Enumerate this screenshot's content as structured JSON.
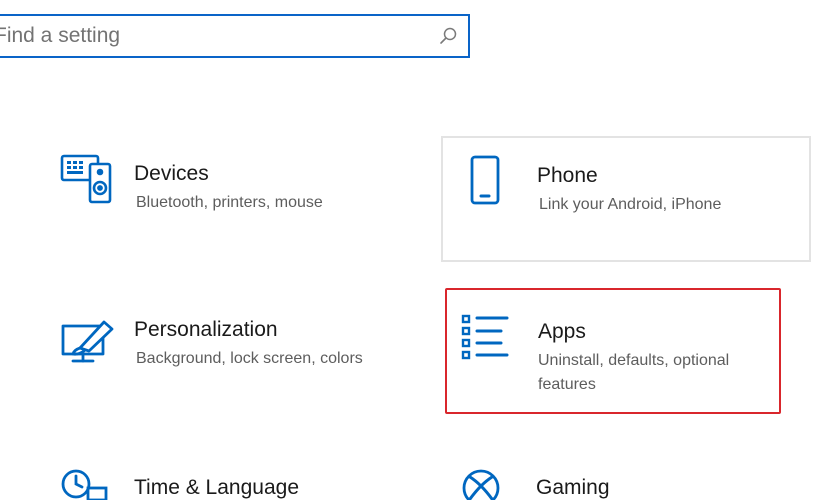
{
  "search": {
    "placeholder": "Find a setting"
  },
  "tiles": [
    {
      "title": "Devices",
      "description": "Bluetooth, printers, mouse",
      "icon": "devices-icon"
    },
    {
      "title": "Phone",
      "description": "Link your Android, iPhone",
      "icon": "phone-icon"
    },
    {
      "title": "Personalization",
      "description": "Background, lock screen, colors",
      "icon": "personalization-icon"
    },
    {
      "title": "Apps",
      "description": "Uninstall, defaults, optional features",
      "icon": "apps-icon"
    },
    {
      "title": "Time & Language",
      "description": "",
      "icon": "time-language-icon"
    },
    {
      "title": "Gaming",
      "description": "",
      "icon": "xbox-icon"
    }
  ],
  "colors": {
    "accent": "#0a64c8",
    "icon": "#0067c0",
    "highlight": "#d9262c"
  }
}
